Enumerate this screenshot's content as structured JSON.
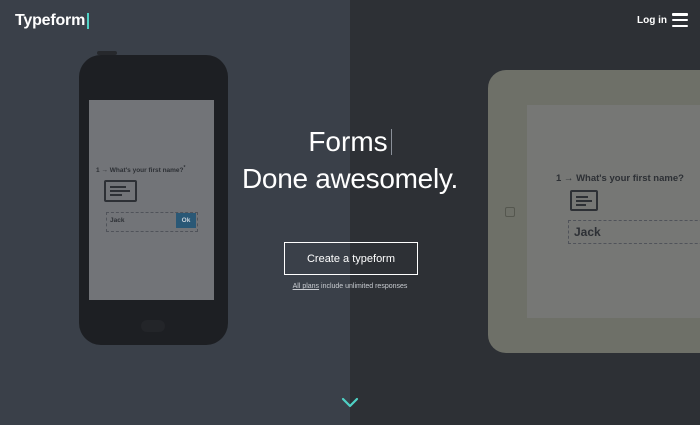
{
  "header": {
    "logo_text": "Typeform",
    "login_label": "Log in",
    "menu_icon": "hamburger-icon"
  },
  "hero": {
    "title": "Forms",
    "subtitle": "Done awesomely.",
    "cta_label": "Create a typeform",
    "plans_link": "All plans",
    "plans_rest": " include unlimited responses"
  },
  "phone_form": {
    "question_number": "1 →",
    "question": "What's your first name?",
    "required_mark": "*",
    "answer_value": "Jack",
    "ok_label": "Ok"
  },
  "tablet_form": {
    "question_number": "1 →",
    "question": "What's your first name?",
    "answer_value": "Jack"
  },
  "colors": {
    "accent": "#4fd1c5",
    "left_panel": "#3a4049",
    "right_panel": "#2d3035"
  },
  "icons": {
    "scroll_down": "chevron-down-icon",
    "card": "id-card-icon"
  }
}
